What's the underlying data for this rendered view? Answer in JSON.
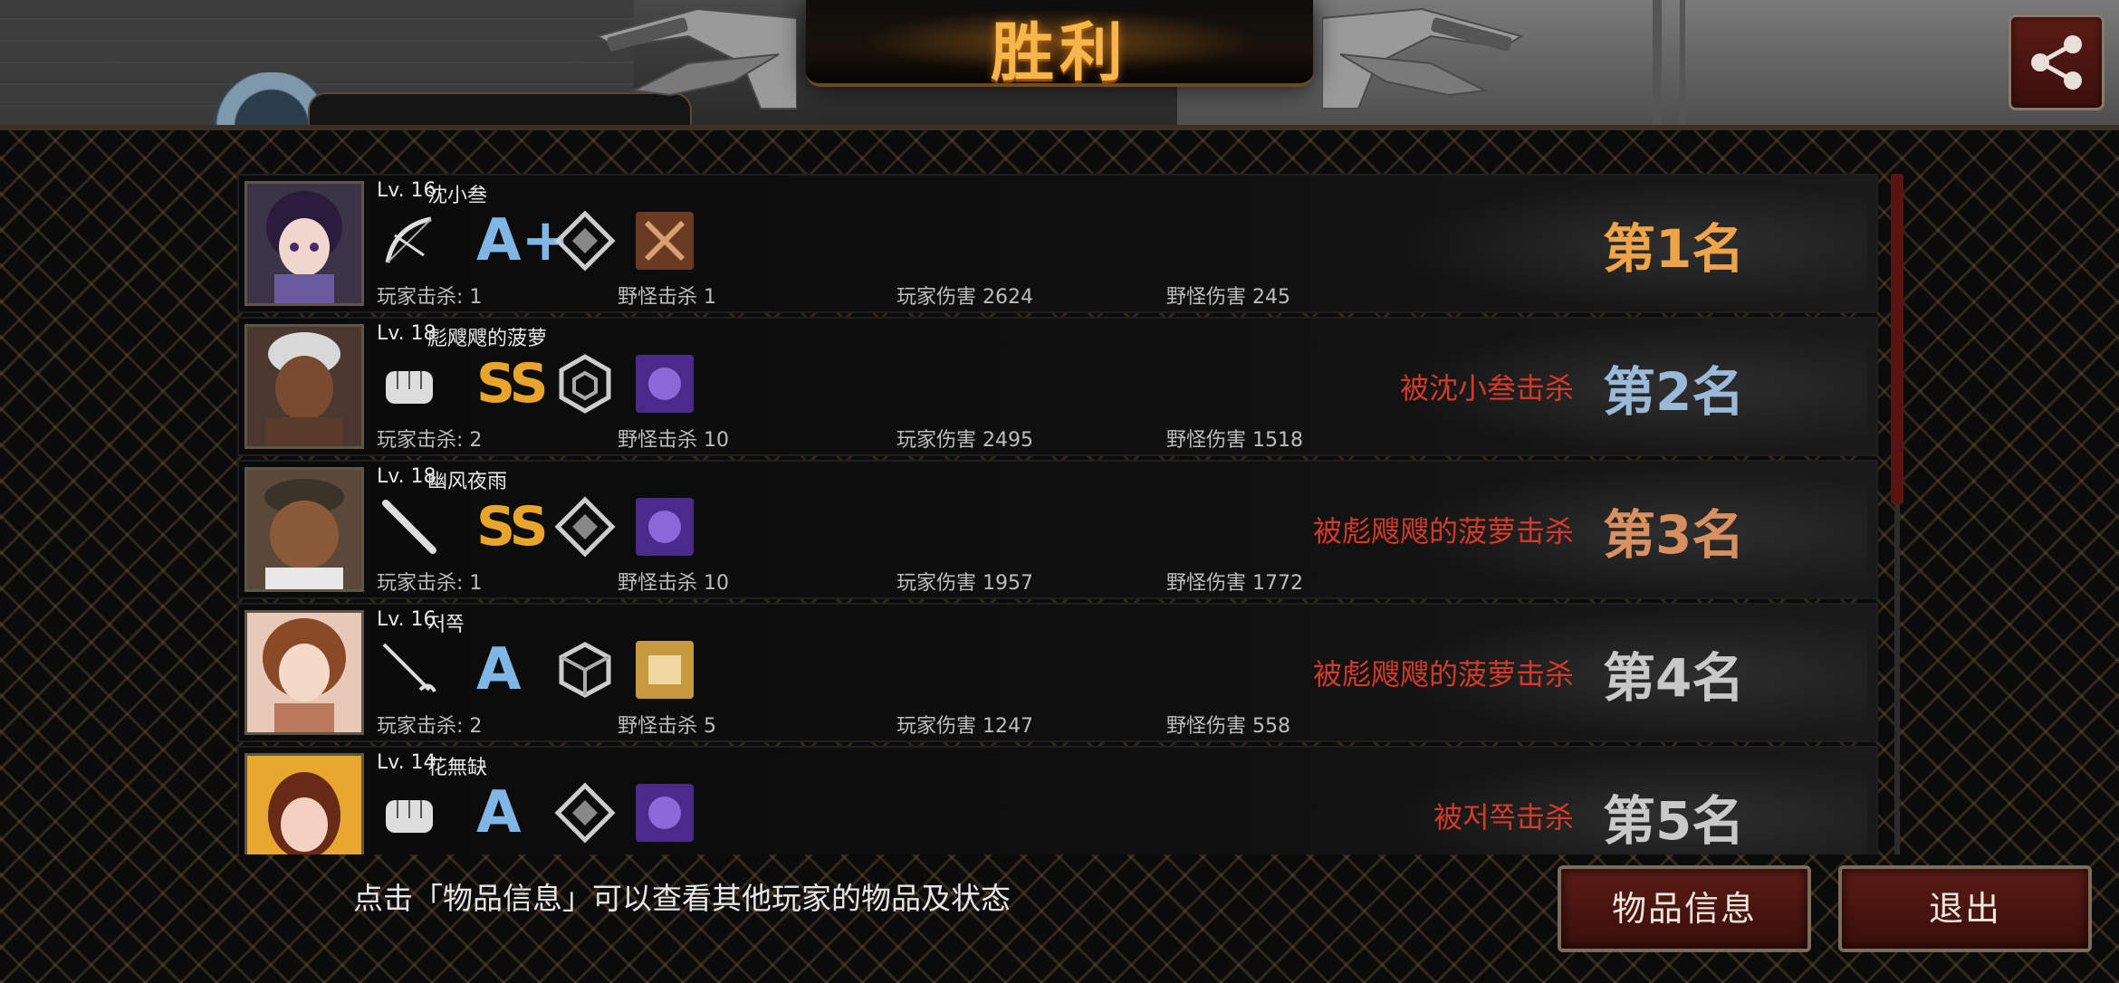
{
  "header": {
    "title": "胜利",
    "top_name_fragment": "沈小参"
  },
  "players": [
    {
      "level": "Lv. 16",
      "name": "沈小叁",
      "weapon_icon": "bow-icon",
      "grade": "A+",
      "role_icon": "diamond-emblem-icon",
      "item_icon": "crossed-swords-item-icon",
      "item_color": "#6a3a22",
      "player_kills": "玩家击杀: 1",
      "monster_kills": "野怪击杀 1",
      "player_damage": "玩家伤害 2624",
      "monster_damage": "野怪伤害 245",
      "killed_by": "",
      "rank": "第1名",
      "rank_color": "#f0a44a"
    },
    {
      "level": "Lv. 18",
      "name": "彪飕飕的菠萝",
      "weapon_icon": "fist-icon",
      "grade": "SS",
      "role_icon": "hexagon-emblem-icon",
      "item_icon": "purple-creature-item-icon",
      "item_color": "#4a2a8a",
      "player_kills": "玩家击杀: 2",
      "monster_kills": "野怪击杀 10",
      "player_damage": "玩家伤害 2495",
      "monster_damage": "野怪伤害 1518",
      "killed_by": "被沈小叁击杀",
      "rank": "第2名",
      "rank_color": "#9ab8d8"
    },
    {
      "level": "Lv. 18",
      "name": "幽风夜雨",
      "weapon_icon": "bat-icon",
      "grade": "SS",
      "role_icon": "diamond-emblem-icon",
      "item_icon": "purple-creature-item-icon",
      "item_color": "#4a2a8a",
      "player_kills": "玩家击杀: 1",
      "monster_kills": "野怪击杀 10",
      "player_damage": "玩家伤害 1957",
      "monster_damage": "野怪伤害 1772",
      "killed_by": "被彪飕飕的菠萝击杀",
      "rank": "第3名",
      "rank_color": "#d89060"
    },
    {
      "level": "Lv. 16",
      "name": "저쪽",
      "weapon_icon": "rapier-icon",
      "grade": "A",
      "role_icon": "cube-emblem-icon",
      "item_icon": "gold-scroll-item-icon",
      "item_color": "#c89a40",
      "player_kills": "玩家击杀: 2",
      "monster_kills": "野怪击杀 5",
      "player_damage": "玩家伤害 1247",
      "monster_damage": "野怪伤害 558",
      "killed_by": "被彪飕飕的菠萝击杀",
      "rank": "第4名",
      "rank_color": "#c8c8c8"
    },
    {
      "level": "Lv. 14",
      "name": "花無缺",
      "weapon_icon": "fist-icon",
      "grade": "A",
      "role_icon": "diamond-emblem-icon",
      "item_icon": "purple-creature-item-icon",
      "item_color": "#4a2a8a",
      "player_kills": "",
      "monster_kills": "",
      "player_damage": "",
      "monster_damage": "",
      "killed_by": "被저쪽击杀",
      "rank": "第5名",
      "rank_color": "#c8c8c8"
    }
  ],
  "footer": {
    "hint": "点击「物品信息」可以查看其他玩家的物品及状态",
    "info_button": "物品信息",
    "exit_button": "退出"
  }
}
